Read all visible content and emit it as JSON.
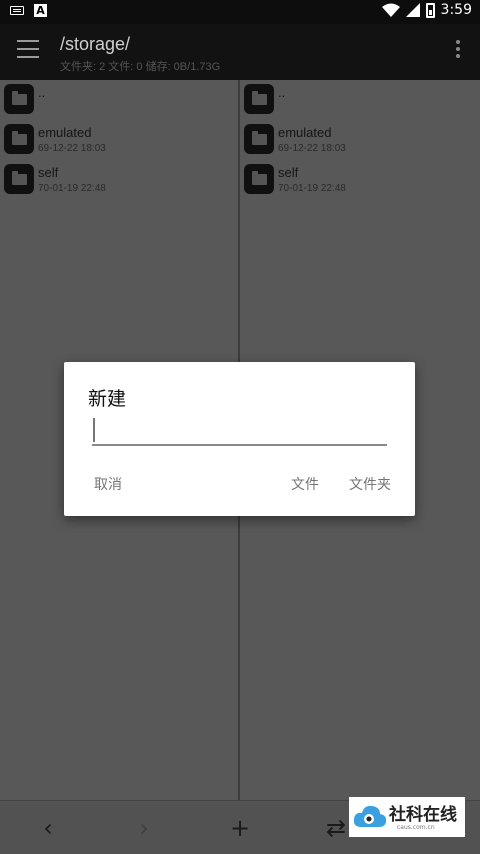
{
  "status_bar": {
    "time": "3:59",
    "icons": [
      "keyboard-icon",
      "a-app-icon",
      "wifi-icon",
      "signal-icon",
      "battery-charging-icon"
    ]
  },
  "app_bar": {
    "path": "/storage/",
    "info": "文件夹: 2  文件: 0  储存: 0B/1.73G"
  },
  "panes": [
    {
      "items": [
        {
          "name": "..",
          "date": ""
        },
        {
          "name": "emulated",
          "date": "69-12-22 18:03"
        },
        {
          "name": "self",
          "date": "70-01-19 22:48"
        }
      ]
    },
    {
      "items": [
        {
          "name": "..",
          "date": ""
        },
        {
          "name": "emulated",
          "date": "69-12-22 18:03"
        },
        {
          "name": "self",
          "date": "70-01-19 22:48"
        }
      ]
    }
  ],
  "dialog": {
    "title": "新建",
    "input_value": "",
    "cancel": "取消",
    "file": "文件",
    "folder": "文件夹"
  },
  "watermark": {
    "name": "社科在线",
    "domain": "caus.com.cn"
  },
  "colors": {
    "dialog_bg": "#ffffff",
    "pane_bg": "#585858",
    "appbar_bg": "#121212"
  }
}
